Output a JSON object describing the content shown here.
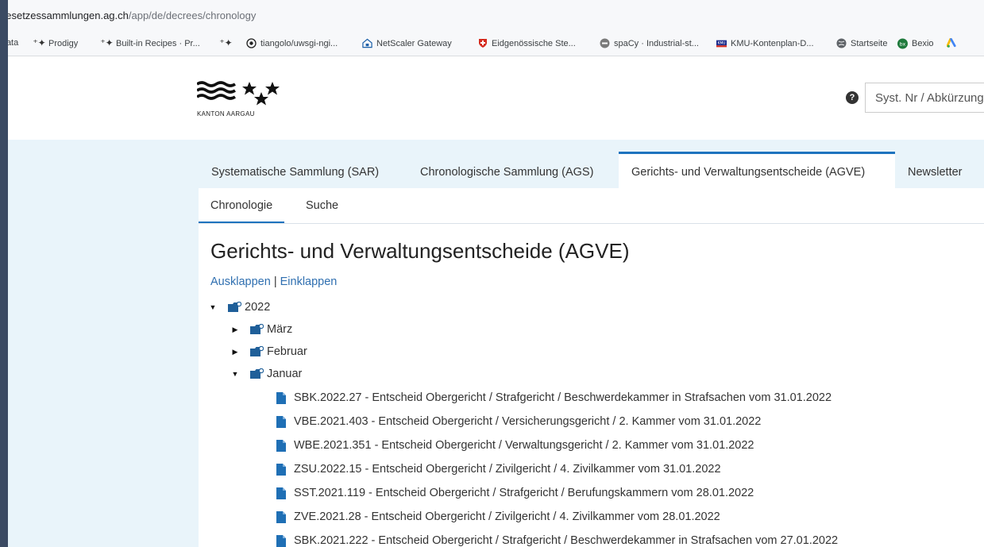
{
  "browser": {
    "url_host": "gesetzessammlungen.ag.ch",
    "url_path": "/app/de/decrees/chronology",
    "bookmarks": [
      {
        "label": "Data",
        "icon": "none"
      },
      {
        "label": "Prodigy",
        "icon": "sparkle-icon"
      },
      {
        "label": "Built-in Recipes · Pr...",
        "icon": "sparkle-icon"
      },
      {
        "label": "",
        "icon": "sparkle-icon"
      },
      {
        "label": "tiangolo/uwsgi-ngi...",
        "icon": "github-icon"
      },
      {
        "label": "NetScaler Gateway",
        "icon": "lock-house-icon"
      },
      {
        "label": "Eidgenössische Ste...",
        "icon": "swiss-shield-icon"
      },
      {
        "label": "spaCy · Industrial-st...",
        "icon": "spacy-icon"
      },
      {
        "label": "KMU-Kontenplan-D...",
        "icon": "kmu-icon"
      },
      {
        "label": "Startseite",
        "icon": "globe-icon"
      },
      {
        "label": "Bexio",
        "icon": "bexio-icon"
      }
    ]
  },
  "site": {
    "logo_text": "KANTON AARGAU",
    "help_label": "?",
    "search_placeholder": "Syst. Nr / Abkürzung",
    "main_tabs": [
      {
        "label": "Systematische Sammlung (SAR)",
        "active": false
      },
      {
        "label": "Chronologische Sammlung (AGS)",
        "active": false
      },
      {
        "label": "Gerichts- und Verwaltungsentscheide (AGVE)",
        "active": true
      },
      {
        "label": "Newsletter",
        "active": false
      }
    ],
    "sub_tabs": [
      {
        "label": "Chronologie",
        "active": true
      },
      {
        "label": "Suche",
        "active": false
      }
    ],
    "page_title": "Gerichts- und Verwaltungsentscheide (AGVE)",
    "expand_label": "Ausklappen",
    "separator": "|",
    "collapse_label": "Einklappen"
  },
  "tree": {
    "year": "2022",
    "months": [
      {
        "label": "März",
        "expanded": false
      },
      {
        "label": "Februar",
        "expanded": false
      },
      {
        "label": "Januar",
        "expanded": true
      }
    ],
    "entries": [
      "SBK.2022.27 - Entscheid Obergericht / Strafgericht / Beschwerdekammer in Strafsachen vom 31.01.2022",
      "VBE.2021.403 - Entscheid Obergericht / Versicherungsgericht / 2. Kammer vom 31.01.2022",
      "WBE.2021.351 - Entscheid Obergericht / Verwaltungsgericht / 2. Kammer vom 31.01.2022",
      "ZSU.2022.15 - Entscheid Obergericht / Zivilgericht / 4. Zivilkammer vom 31.01.2022",
      "SST.2021.119 - Entscheid Obergericht / Strafgericht / Berufungskammern vom 28.01.2022",
      "ZVE.2021.28 - Entscheid Obergericht / Zivilgericht / 4. Zivilkammer vom 28.01.2022",
      "SBK.2021.222 - Entscheid Obergericht / Strafgericht / Beschwerdekammer in Strafsachen vom 27.01.2022"
    ]
  },
  "colors": {
    "accent": "#1e73be",
    "link": "#2f6fb0",
    "nav_background": "#e9f4fa",
    "window_frame": "#3b4a63"
  }
}
